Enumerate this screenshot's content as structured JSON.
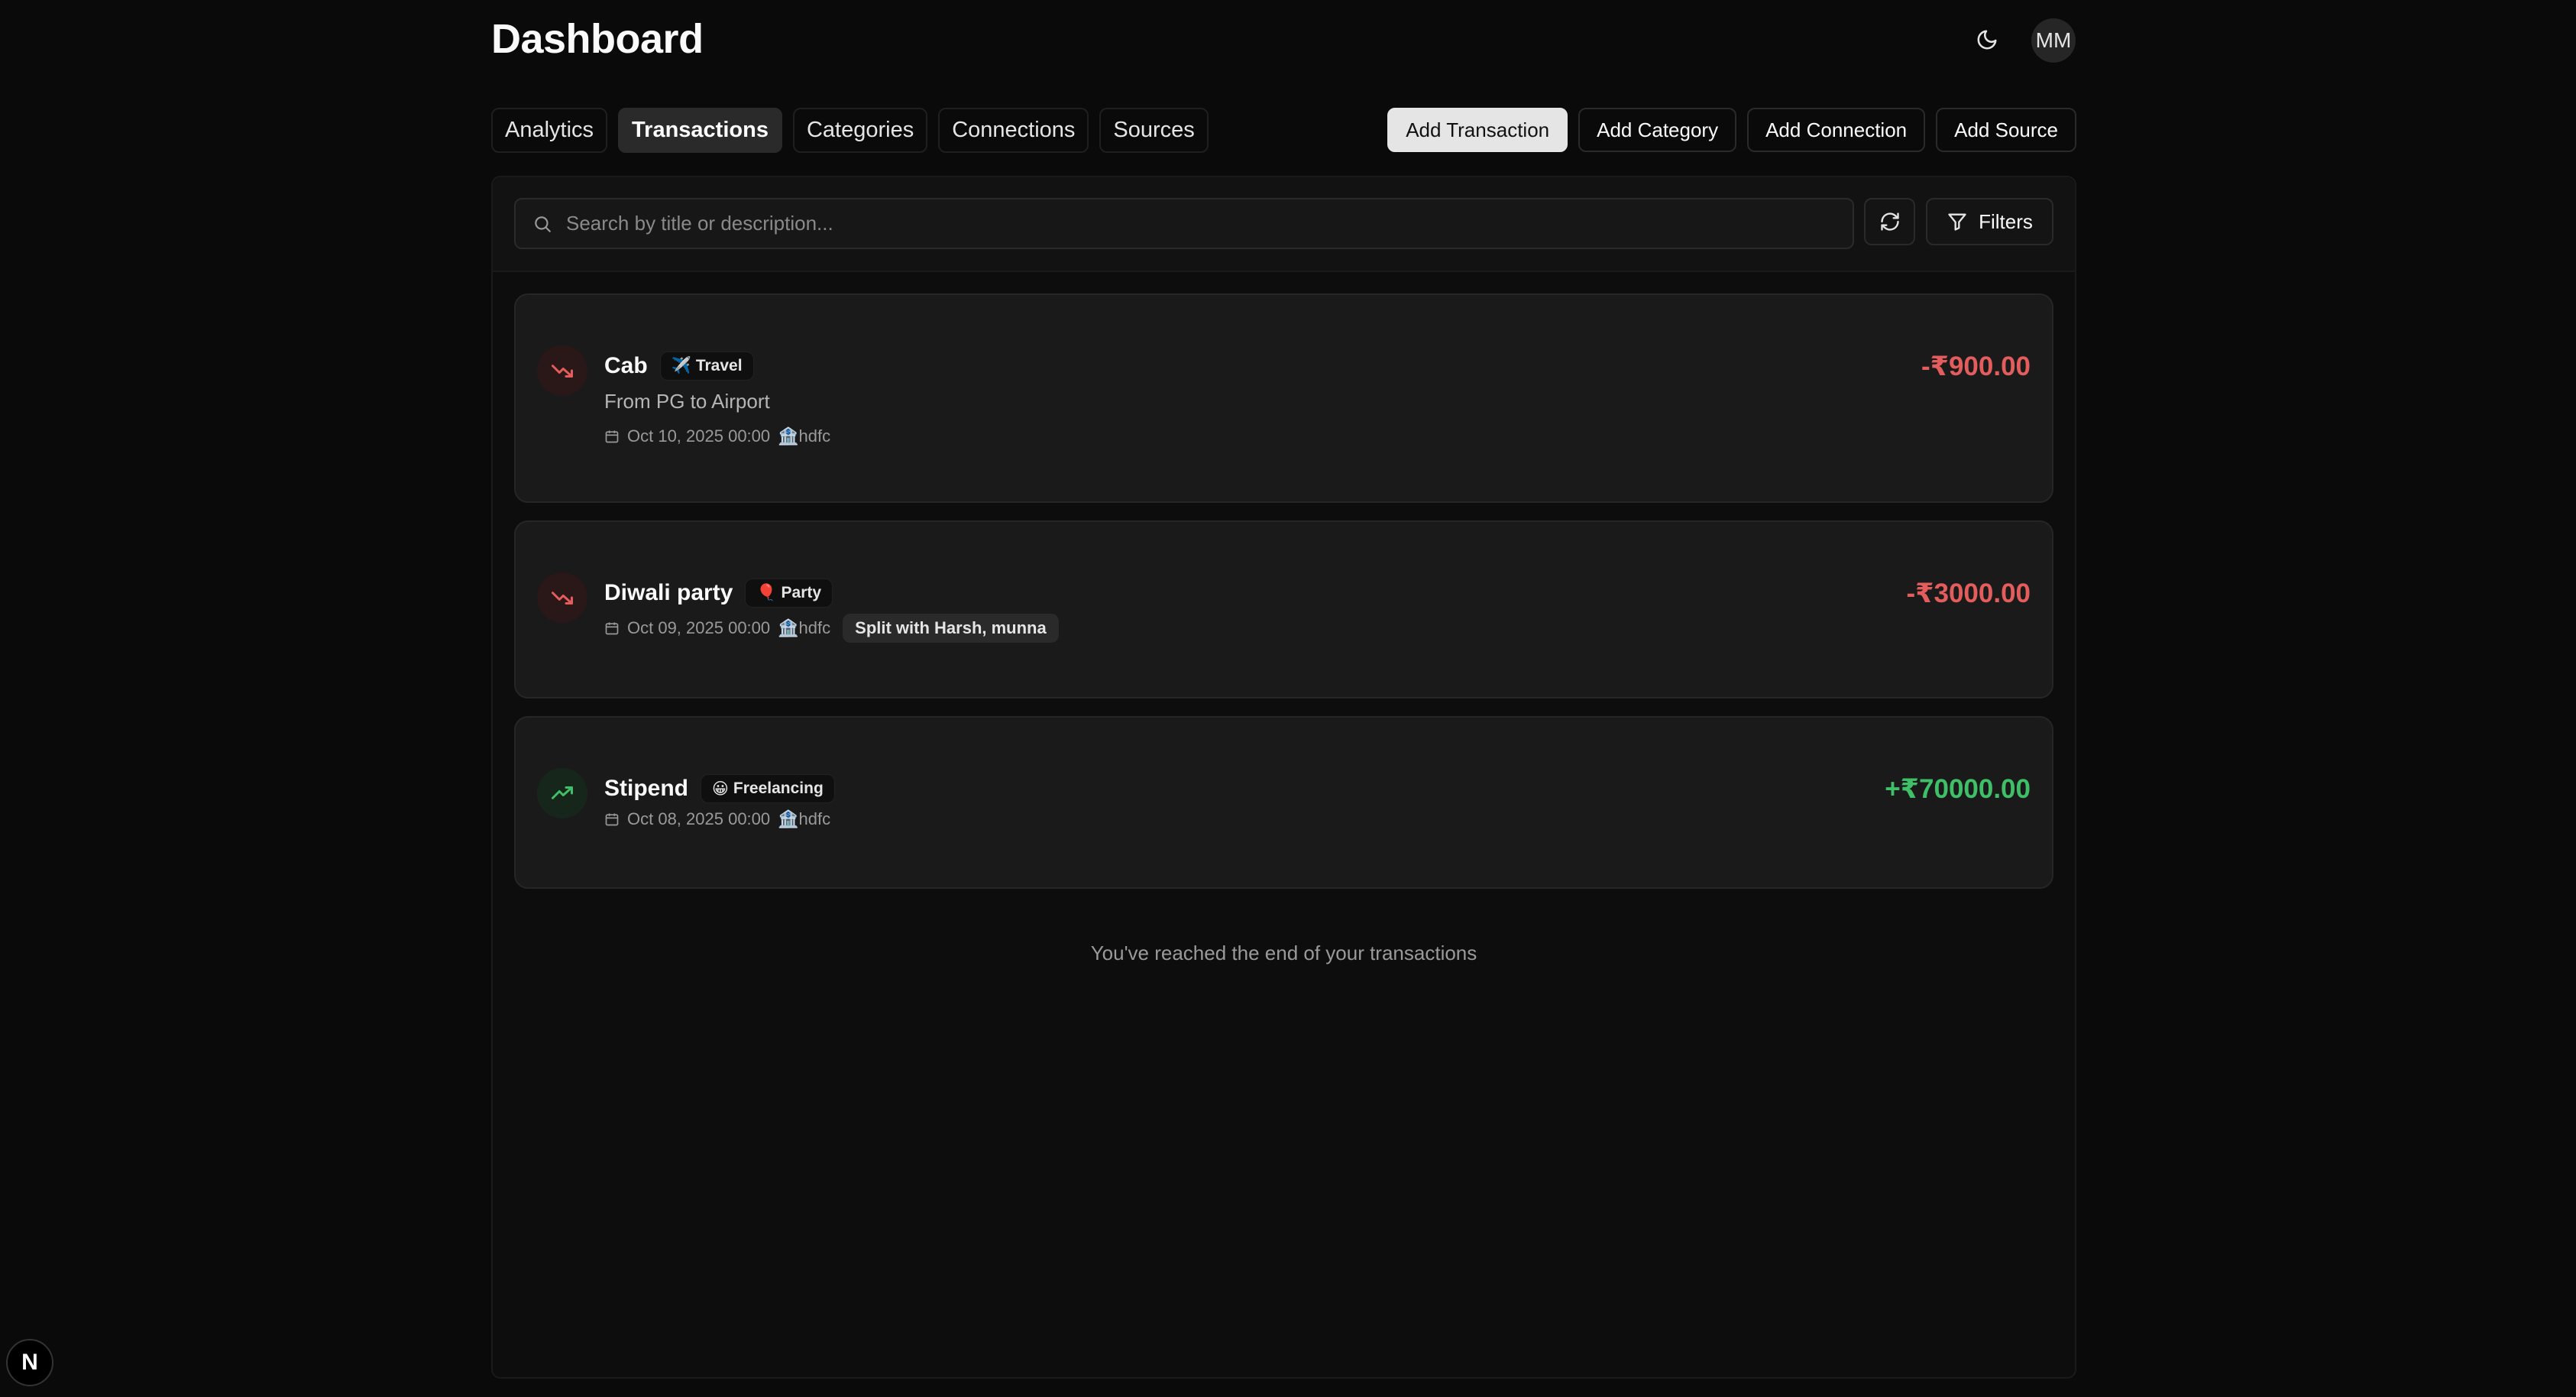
{
  "header": {
    "title": "Dashboard",
    "avatar_initials": "MM"
  },
  "tabs": [
    {
      "label": "Analytics"
    },
    {
      "label": "Transactions",
      "active": true
    },
    {
      "label": "Categories"
    },
    {
      "label": "Connections"
    },
    {
      "label": "Sources"
    }
  ],
  "actions": {
    "add_transaction": "Add Transaction",
    "add_category": "Add Category",
    "add_connection": "Add Connection",
    "add_source": "Add Source"
  },
  "search": {
    "placeholder": "Search by title or description...",
    "value": ""
  },
  "filters_label": "Filters",
  "transactions": [
    {
      "title": "Cab",
      "category_emoji": "✈️",
      "category": "Travel",
      "description": "From PG to Airport",
      "date": "Oct 10, 2025 00:00",
      "source_emoji": "🏦",
      "source": "hdfc",
      "amount": "-₹900.00",
      "type": "expense"
    },
    {
      "title": "Diwali party",
      "category_emoji": "🎈",
      "category": "Party",
      "date": "Oct 09, 2025 00:00",
      "source_emoji": "🏦",
      "source": "hdfc",
      "split": "Split with Harsh, munna",
      "amount": "-₹3000.00",
      "type": "expense"
    },
    {
      "title": "Stipend",
      "category_emoji": "😀",
      "category": "Freelancing",
      "date": "Oct 08, 2025 00:00",
      "source_emoji": "🏦",
      "source": "hdfc",
      "amount": "+₹70000.00",
      "type": "income"
    }
  ],
  "end_message": "You've reached the end of your transactions",
  "colors": {
    "negative": "#e35d5d",
    "positive": "#3fbf67",
    "background": "#0a0a0a"
  },
  "icons": {
    "theme": "moon-icon",
    "search": "search-icon",
    "refresh": "refresh-icon",
    "filter": "filter-icon",
    "expense": "trending-down-icon",
    "income": "trending-up-icon",
    "date": "calendar-icon",
    "devtools": "nextjs-logo"
  }
}
